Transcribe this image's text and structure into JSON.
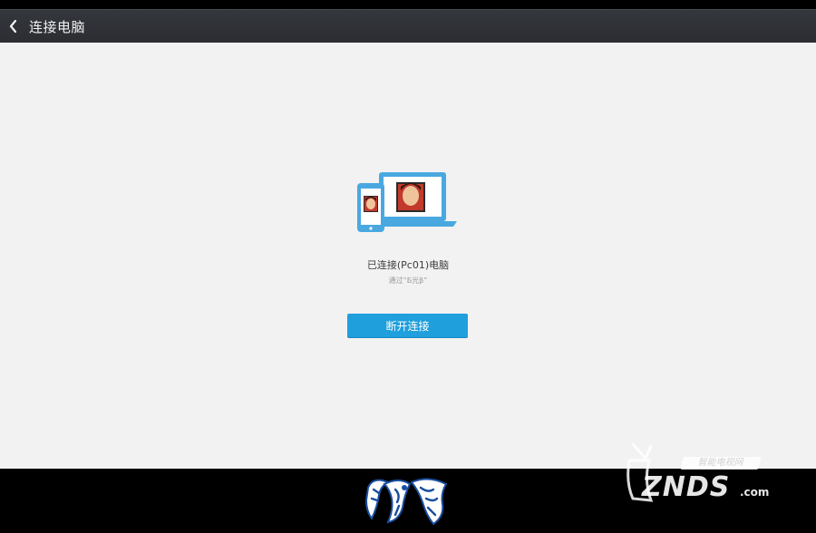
{
  "header": {
    "title": "连接电脑",
    "back_icon": "chevron-left-icon"
  },
  "main": {
    "illustration_icon": "phone-laptop-connected-icon",
    "status": "已连接(Pc01)电脑",
    "via": "通过“Б光β”",
    "disconnect_label": "断开连接"
  },
  "watermark": {
    "znds_text": "ZNDS",
    "znds_com": ".com",
    "znds_banner": "智能电视网"
  },
  "colors": {
    "header_bg": "#2e3035",
    "content_bg": "#f2f2f2",
    "accent": "#1f9fdc",
    "illustration_blue": "#4aa8e0"
  }
}
